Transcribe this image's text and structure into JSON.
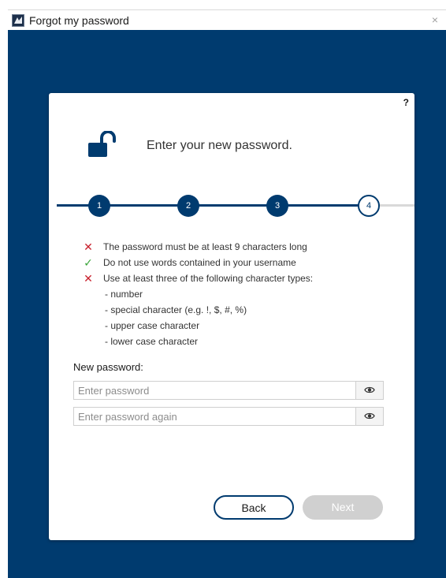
{
  "window": {
    "title": "Forgot my password",
    "close_glyph": "×",
    "icon": "app-icon"
  },
  "card": {
    "help_label": "?",
    "lock_icon": "unlocked-padlock-icon",
    "heading": "Enter your new password."
  },
  "steps": {
    "items": [
      {
        "label": "1",
        "state": "done"
      },
      {
        "label": "2",
        "state": "done"
      },
      {
        "label": "3",
        "state": "done"
      },
      {
        "label": "4",
        "state": "current"
      }
    ],
    "current": 4,
    "total": 4
  },
  "requirements": [
    {
      "text": "The password must be at least 9 characters long",
      "status": "fail",
      "mark": "✕"
    },
    {
      "text": "Do not use words contained in your username",
      "status": "pass",
      "mark": "✓"
    },
    {
      "text": "Use at least three of the following character types:",
      "status": "fail",
      "mark": "✕"
    }
  ],
  "character_types": [
    "- number",
    "- special character (e.g. !, $, #, %)",
    "- upper case character",
    "- lower case character"
  ],
  "form": {
    "label": "New password:",
    "password": {
      "value": "",
      "placeholder": "Enter password"
    },
    "password_again": {
      "value": "",
      "placeholder": "Enter password again"
    },
    "reveal_icon": "eye-icon"
  },
  "buttons": {
    "back": "Back",
    "next": "Next"
  },
  "colors": {
    "brand": "#003b6f",
    "fail": "#c8202c",
    "pass": "#3aa53a",
    "disabled": "#d0d0d0"
  }
}
